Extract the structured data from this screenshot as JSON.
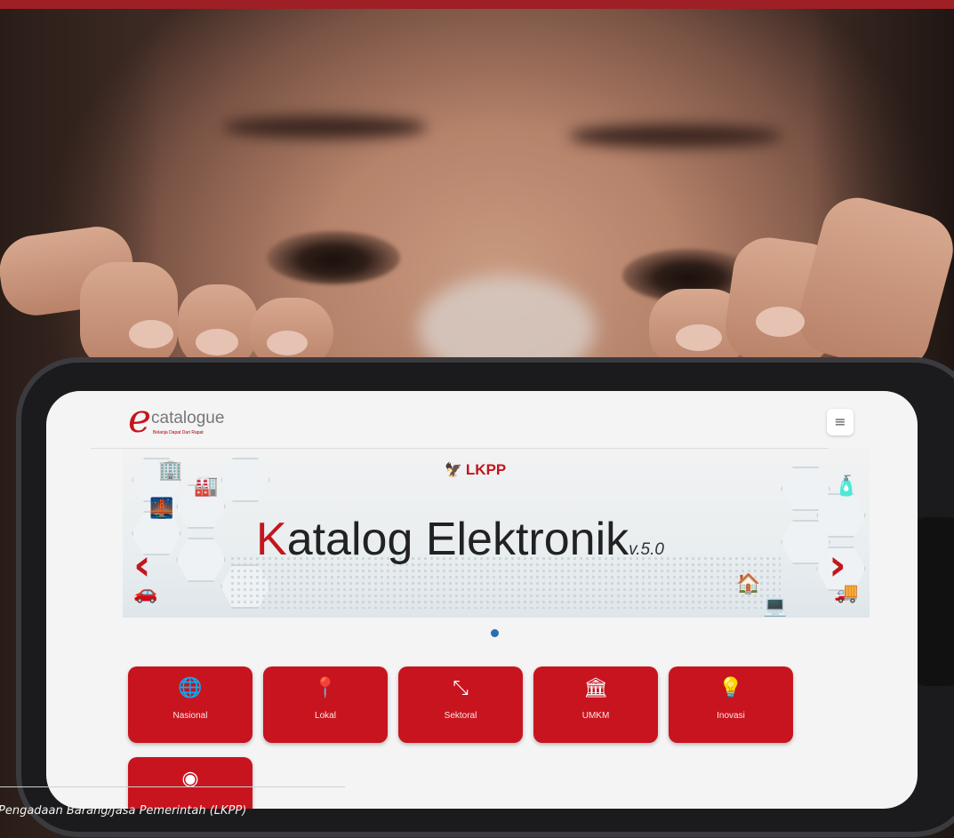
{
  "app": {
    "logo_text": "catalogue",
    "logo_subtitle": "Belanja Dapat Dari Rapat",
    "menu_icon": "hamburger-icon"
  },
  "banner": {
    "org": "LKPP",
    "title_first_letter": "K",
    "title_rest": "atalog Elektronik",
    "version": "v.5.0",
    "prev_icon": "chevron-left-icon",
    "next_icon": "chevron-right-icon"
  },
  "categories": [
    {
      "label": "Nasional",
      "icon": "globe-icon",
      "glyph": "🌐"
    },
    {
      "label": "Lokal",
      "icon": "map-pin-icon",
      "glyph": "📍"
    },
    {
      "label": "Sektoral",
      "icon": "resize-icon",
      "glyph": "⤡"
    },
    {
      "label": "UMKM",
      "icon": "bank-icon",
      "glyph": "🏛"
    },
    {
      "label": "Inovasi",
      "icon": "lightbulb-icon",
      "glyph": "💡"
    },
    {
      "label": "",
      "icon": "badge-icon",
      "glyph": "◉"
    }
  ],
  "caption": "Pengadaan Barang/Jasa Pemerintah (LKPP)",
  "colors": {
    "brand_red": "#c8141f",
    "top_bar": "#9e1f25",
    "indicator": "#2a6db3"
  }
}
